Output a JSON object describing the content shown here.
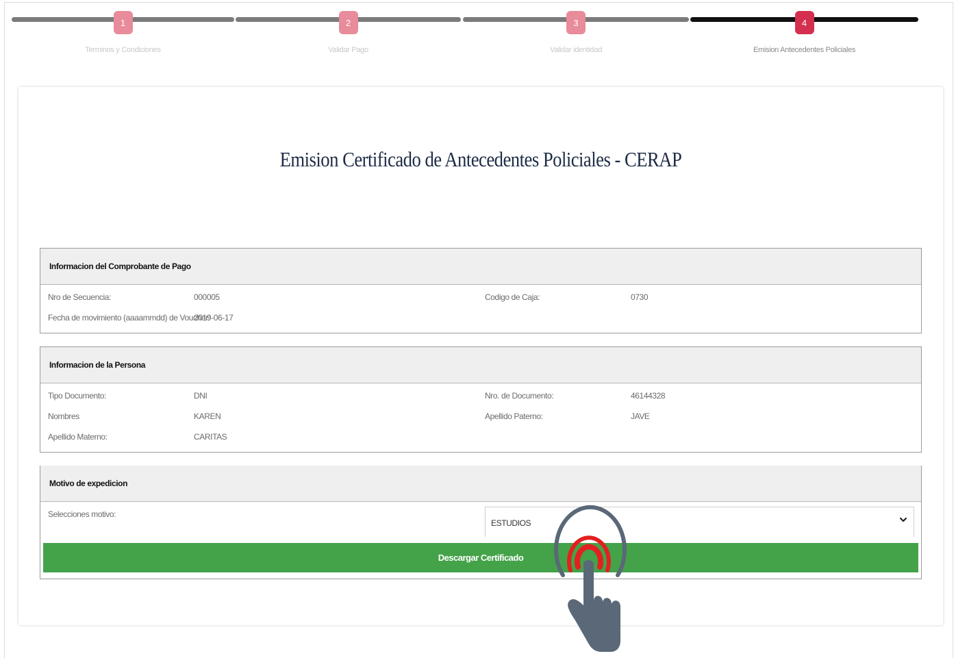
{
  "stepper": {
    "steps": [
      {
        "number": "1",
        "label": "Terminos y Condiciones",
        "active": false
      },
      {
        "number": "2",
        "label": "Validar Pago",
        "active": false
      },
      {
        "number": "3",
        "label": "Validar identidad",
        "active": false
      },
      {
        "number": "4",
        "label": "Emision Antecedentes Policiales",
        "active": true
      }
    ]
  },
  "page_title": "Emision Certificado de Antecedentes Policiales - CERAP",
  "pago": {
    "header": "Informacion del Comprobante de Pago",
    "secuencia_label": "Nro de Secuencia:",
    "secuencia_value": "000005",
    "caja_label": "Codigo de Caja:",
    "caja_value": "0730",
    "fecha_label": "Fecha de movimiento (aaaammdd) de Voucher:",
    "fecha_value": "2019-06-17"
  },
  "persona": {
    "header": "Informacion de la Persona",
    "tipo_label": "Tipo Documento:",
    "tipo_value": "DNI",
    "nro_label": "Nro. de Documento:",
    "nro_value": "46144328",
    "nombres_label": "Nombres",
    "nombres_value": "KAREN",
    "paterno_label": "Apellido Paterno:",
    "paterno_value": "JAVE",
    "materno_label": "Apellido Materno:",
    "materno_value": "CARITAS"
  },
  "motivo": {
    "header": "Motivo de expedicion",
    "select_label": "Selecciones motivo:",
    "selected": "ESTUDIOS"
  },
  "download_button": "Descargar Certificado",
  "colors": {
    "step_inactive": "#e88b9a",
    "step_active": "#d42f4e",
    "button_green": "#44a249",
    "title": "#1d2b45"
  }
}
